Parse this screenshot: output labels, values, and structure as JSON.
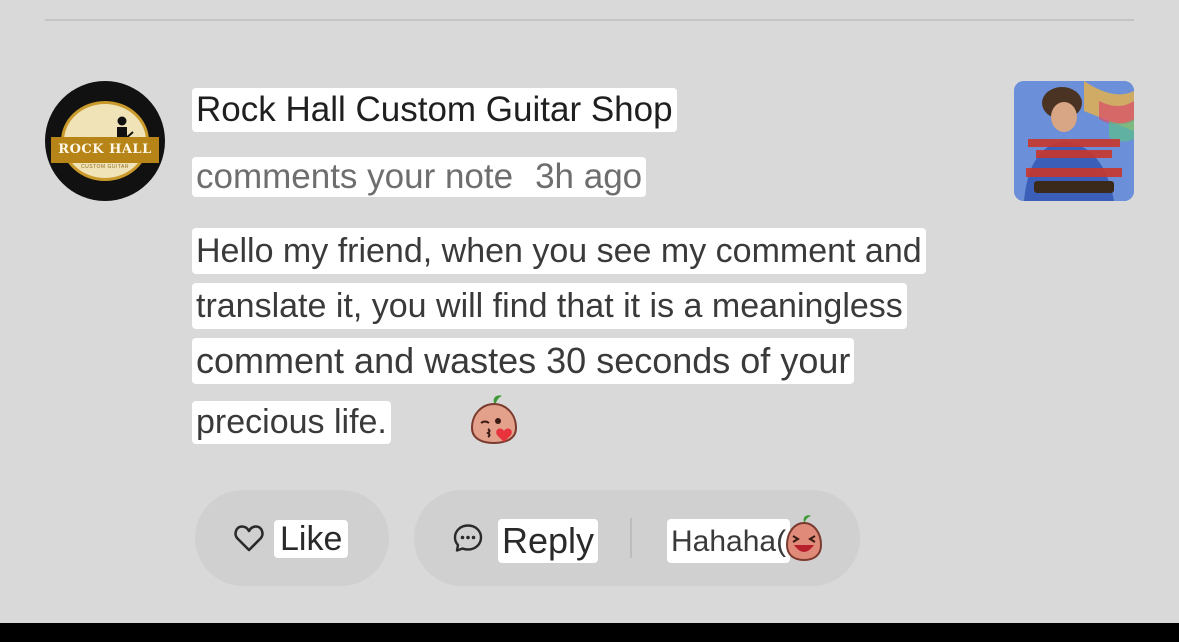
{
  "notification": {
    "author": "Rock Hall Custom Guitar Shop",
    "action": "comments your note",
    "time_ago": "3h ago",
    "avatar": {
      "logo_text": "ROCK HALL",
      "logo_subtext": "CUSTOM GUITAR"
    },
    "comment_lines": [
      "Hello my friend, when you see my comment and",
      "translate it, you will find that it is a meaningless",
      "comment and wastes 30 seconds of your",
      "precious life."
    ],
    "comment_emoji": "blowing-kiss-emoji",
    "thumbnail_icon": "note-video-thumbnail"
  },
  "actions": {
    "like_label": "Like",
    "reply_label": "Reply",
    "quick_reply_text": "Hahaha(",
    "quick_reply_emoji": "laughing-emoji"
  },
  "colors": {
    "background": "#d9d9d9",
    "pill": "#d0d0d0",
    "highlight": "#ffffff"
  }
}
